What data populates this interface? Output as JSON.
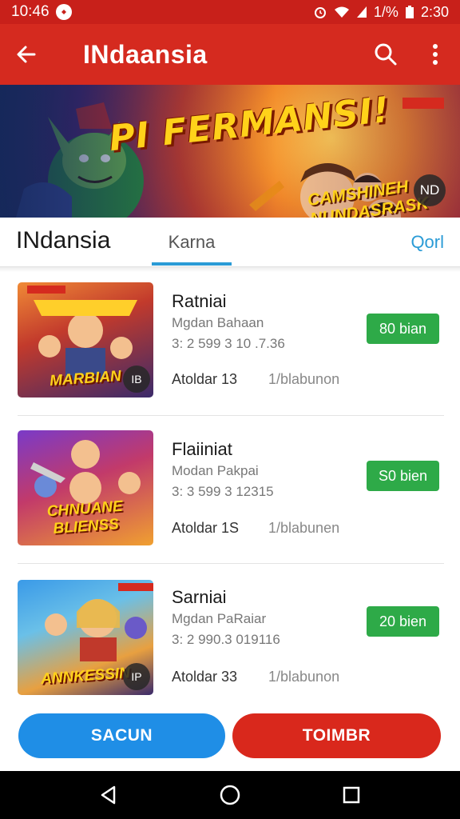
{
  "status_bar": {
    "time": "10:46",
    "battery_text": "1/%",
    "clock_right": "2:30"
  },
  "app_bar": {
    "title": "INdaansia"
  },
  "banner": {
    "title_art": "PI FERMANSI!",
    "sub_art": "CAMSHINEH NUNDASRASK",
    "badge": "ND"
  },
  "tabs": {
    "main": "INdansia",
    "selected": "Karna",
    "right": "Qorl"
  },
  "items": [
    {
      "name": "Ratniai",
      "meta1": "Mgdan Bahaan",
      "meta2": "3: 2 599 3 10 .7.36",
      "foot_a": "Atoldar 13",
      "foot_b": "1/blabunon",
      "price": "80 bian",
      "thumb_text": "MARBIAN",
      "thumb_badge": "IB"
    },
    {
      "name": "Flaiiniat",
      "meta1": "Modan Pakpai",
      "meta2": "3: 3 599 3 12315",
      "foot_a": "Atoldar 1S",
      "foot_b": "1/blabunen",
      "price": "S0 bien",
      "thumb_text": "CHNUANE BLIENSS",
      "thumb_badge": ""
    },
    {
      "name": "Sarniai",
      "meta1": "Mgdan PaRaiar",
      "meta2": "3: 2 990.3 019116",
      "foot_a": "Atoldar 33",
      "foot_b": "1/blabunon",
      "price": "20 bien",
      "thumb_text": "ANNKESSIN",
      "thumb_badge": "IP"
    }
  ],
  "buttons": {
    "left": "SACUN",
    "right": "TOIMBR"
  },
  "colors": {
    "primary_red": "#d52a1f",
    "status_red": "#c8201a",
    "accent_blue": "#1f8ee6",
    "tab_blue": "#2a9bd6",
    "price_green": "#2eaa48"
  },
  "icons": {
    "back": "arrow-left-icon",
    "search": "search-icon",
    "menu": "more-vertical-icon",
    "nav_back": "nav-back-icon",
    "nav_home": "nav-home-icon",
    "nav_recent": "nav-recent-icon"
  }
}
